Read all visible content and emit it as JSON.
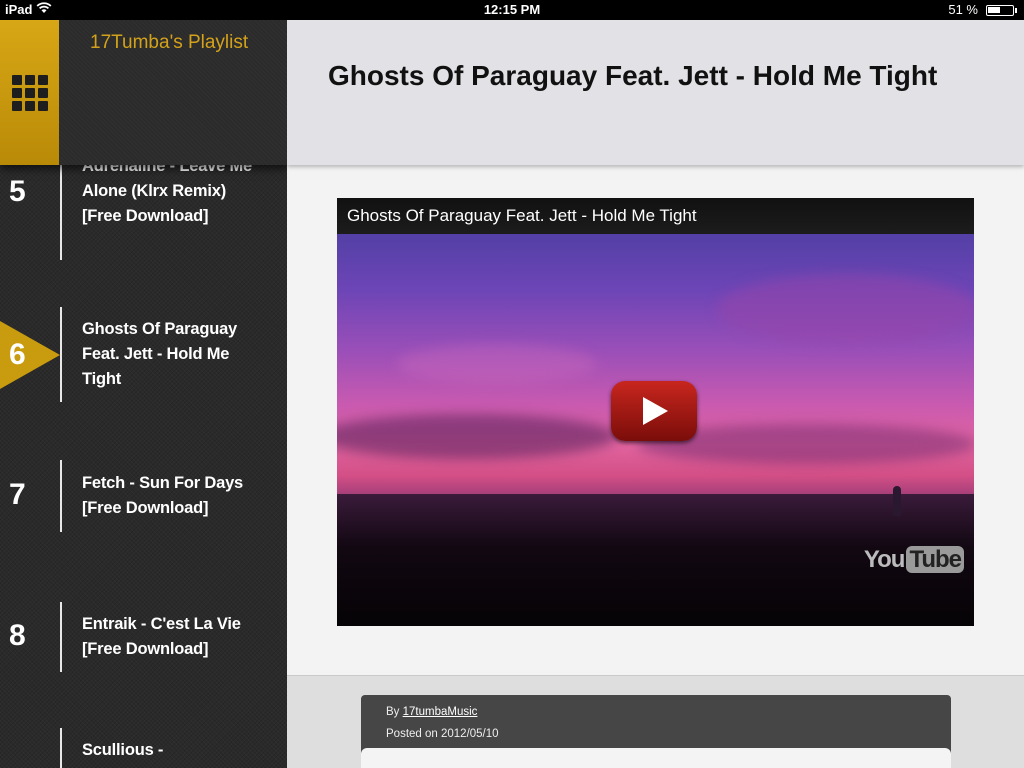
{
  "statusbar": {
    "device": "iPad",
    "time": "12:15 PM",
    "battery": "51 %",
    "battery_level": 0.51
  },
  "sidebar": {
    "playlist_title": "17Tumba's Playlist",
    "menu_icon": "grid-icon",
    "current_index": 1,
    "tracks": [
      {
        "number": "5",
        "title": "Adrenaline - Leave Me Alone (Klrx Remix) [Free Download]"
      },
      {
        "number": "6",
        "title": "Ghosts Of Paraguay Feat. Jett - Hold Me Tight"
      },
      {
        "number": "7",
        "title": "Fetch - Sun For Days [Free Download]"
      },
      {
        "number": "8",
        "title": "Entraik - C'est La Vie [Free Download]"
      },
      {
        "number": "",
        "title": "Scullious -"
      }
    ]
  },
  "main": {
    "title": "Ghosts Of Paraguay Feat. Jett - Hold Me Tight",
    "video": {
      "title": "Ghosts Of Paraguay Feat. Jett - Hold Me Tight",
      "logo_you": "You",
      "logo_tube": "Tube"
    },
    "meta": {
      "by_prefix": "By",
      "author": "17tumbaMusic",
      "posted": "Posted on 2012/05/10"
    }
  },
  "colors": {
    "accent": "#d4a21a",
    "marker": "#c99b0e",
    "play": "#c8261e"
  }
}
